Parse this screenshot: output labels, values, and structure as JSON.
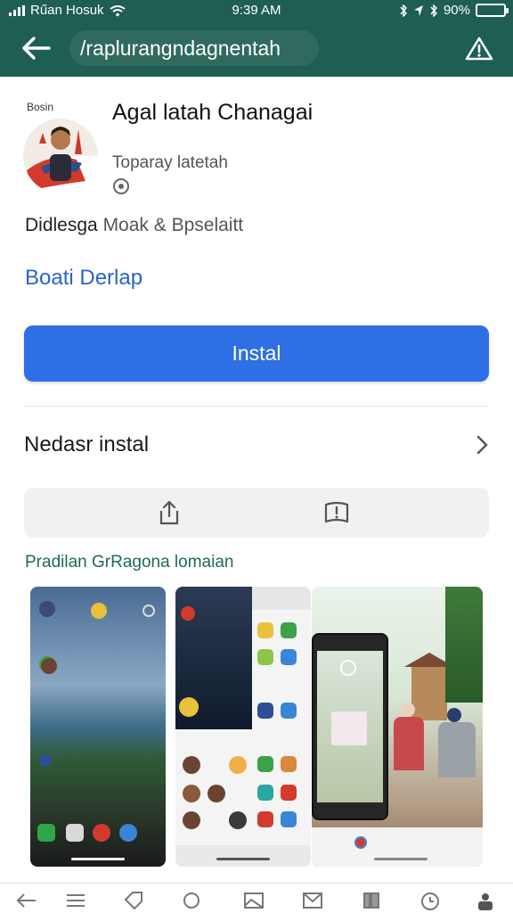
{
  "status_bar": {
    "carrier": "Rűan Hosuk",
    "time": "9:39 AM",
    "battery": "90%",
    "battery_level": 0.9
  },
  "app_bar": {
    "url": "/raplurangndagnentah",
    "back_icon": "arrow-left-icon",
    "warning_icon": "warning-triangle-icon"
  },
  "app": {
    "brand_small": "Bosin",
    "title": "Agal latah Chanagai",
    "subtitle": "Toparay latetah",
    "description_dark": "Didlesga",
    "description_light": "Moak & Bpselaitt",
    "link": "Boati Derlap"
  },
  "install_button": {
    "label": "Instal"
  },
  "details_row": {
    "label": "Nedasr instal",
    "icon": "chevron-right-icon"
  },
  "actions": [
    {
      "icon": "share-icon"
    },
    {
      "icon": "report-book-icon"
    }
  ],
  "screenshots": {
    "title": "Pradilan GrRagona lomaian",
    "count": 3
  },
  "colors": {
    "app_bar": "#1f5e52",
    "install": "#2f6fe6",
    "link": "#2a64c9",
    "section_title": "#1e6b4f"
  }
}
